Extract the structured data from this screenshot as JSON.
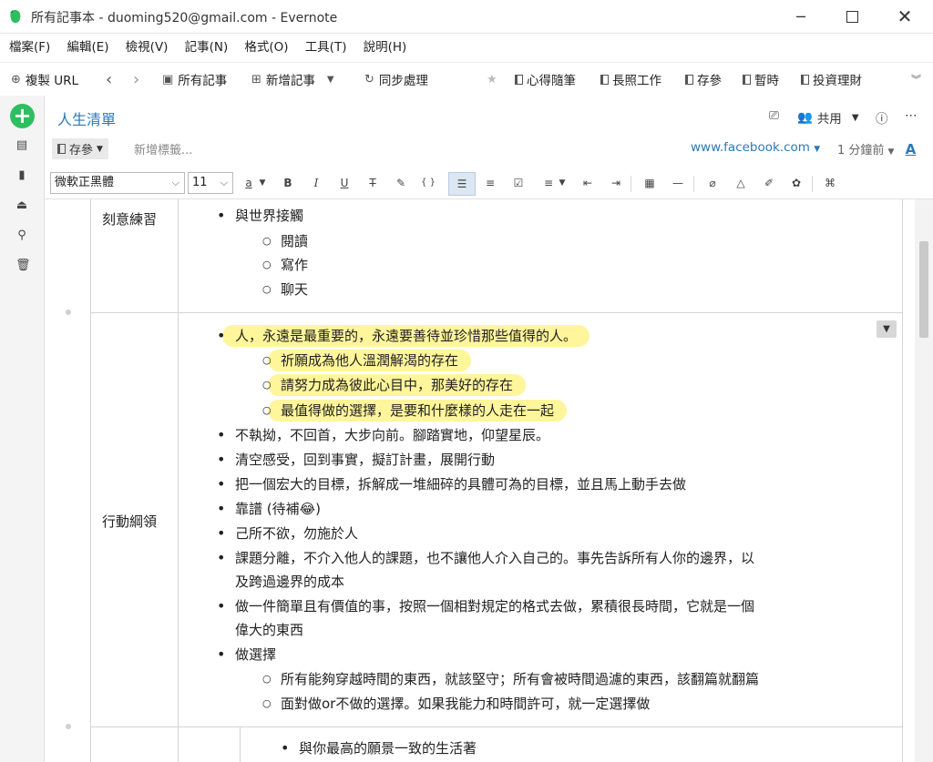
{
  "window": {
    "title": "所有記事本 - duoming520@gmail.com - Evernote"
  },
  "menu": [
    "檔案(F)",
    "編輯(E)",
    "檢視(V)",
    "記事(N)",
    "格式(O)",
    "工具(T)",
    "說明(H)"
  ],
  "toolbar": {
    "copy_url": "複製 URL",
    "all_notes": "所有記事",
    "new_note": "新增記事",
    "sync": "同步處理",
    "shortcuts": [
      "心得隨筆",
      "長照工作",
      "存參",
      "暫時",
      "投資理財"
    ]
  },
  "note": {
    "title": "人生清單",
    "share": "共用",
    "notebook": "存參",
    "tag_placeholder": "新增標籤...",
    "source_url": "www.facebook.com",
    "updated": "1 分鐘前",
    "font_name": "微軟正黑體",
    "font_size": "11"
  },
  "rows": [
    {
      "label": "刻意練習",
      "items": [
        "與世界接觸",
        "閱讀",
        "寫作",
        "聊天"
      ]
    },
    {
      "label": "行動綱領",
      "highlighted": [
        "人，永遠是最重要的，永遠要善待並珍惜那些值得的人。",
        "祈願成為他人溫潤解渴的存在",
        "請努力成為彼此心目中，那美好的存在",
        "最值得做的選擇，是要和什麼樣的人走在一起"
      ],
      "items": [
        "不執拗，不回首，大步向前。腳踏實地，仰望星辰。",
        "清空感受，回到事實，擬訂計畫，展開行動",
        "把一個宏大的目標，拆解成一堆細碎的具體可為的目標，並且馬上動手去做",
        "靠譜 (待補😂)",
        "己所不欲，勿施於人",
        "課題分離，不介入他人的課題，也不讓他人介入自己的。事先告訴所有人你的邊界，以",
        "及跨過邊界的成本",
        "做一件簡單且有價值的事，按照一個相對規定的格式去做，累積很長時間，它就是一個",
        "偉大的東西",
        "做選擇",
        "所有能夠穿越時間的東西，就該堅守；所有會被時間過濾的東西，該翻篇就翻篇",
        "面對做or不做的選擇。如果我能力和時間許可，就一定選擇做"
      ]
    },
    {
      "items": [
        "與你最高的願景一致的生活著"
      ]
    }
  ],
  "colors": {
    "accent": "#2a7ab8",
    "new_button": "#2dbe60",
    "highlight": "#fff59b"
  }
}
